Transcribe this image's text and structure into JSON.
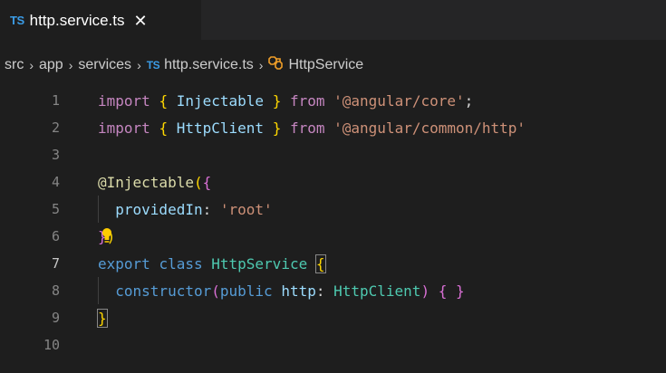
{
  "tab": {
    "badge": "TS",
    "filename": "http.service.ts",
    "close": "✕"
  },
  "breadcrumb": {
    "items": [
      "src",
      "app",
      "services",
      "http.service.ts",
      "HttpService"
    ],
    "file_badge": "TS",
    "separator": "›"
  },
  "editor": {
    "active_line": 7,
    "lines": [
      {
        "n": "1",
        "tokens": [
          [
            "kw-purple",
            "import"
          ],
          [
            "plain",
            " "
          ],
          [
            "brace-y",
            "{"
          ],
          [
            "plain",
            " "
          ],
          [
            "ident",
            "Injectable"
          ],
          [
            "plain",
            " "
          ],
          [
            "brace-y",
            "}"
          ],
          [
            "plain",
            " "
          ],
          [
            "kw-purple",
            "from"
          ],
          [
            "plain",
            " "
          ],
          [
            "str",
            "'@angular/core'"
          ],
          [
            "plain",
            ";"
          ]
        ]
      },
      {
        "n": "2",
        "tokens": [
          [
            "kw-purple",
            "import"
          ],
          [
            "plain",
            " "
          ],
          [
            "brace-y",
            "{"
          ],
          [
            "plain",
            " "
          ],
          [
            "ident",
            "HttpClient"
          ],
          [
            "plain",
            " "
          ],
          [
            "brace-y",
            "}"
          ],
          [
            "plain",
            " "
          ],
          [
            "kw-purple",
            "from"
          ],
          [
            "plain",
            " "
          ],
          [
            "str",
            "'@angular/common/http'"
          ]
        ]
      },
      {
        "n": "3",
        "tokens": []
      },
      {
        "n": "4",
        "tokens": [
          [
            "fn",
            "@Injectable"
          ],
          [
            "brace-y",
            "("
          ],
          [
            "brace-p",
            "{"
          ]
        ]
      },
      {
        "n": "5",
        "tokens": [
          [
            "plain",
            "  "
          ],
          [
            "ident",
            "providedIn"
          ],
          [
            "plain",
            ": "
          ],
          [
            "str",
            "'root'"
          ]
        ]
      },
      {
        "n": "6",
        "tokens": [
          [
            "brace-p",
            "}"
          ],
          [
            "brace-y",
            ")"
          ]
        ]
      },
      {
        "n": "7",
        "tokens": [
          [
            "kw-blue",
            "export"
          ],
          [
            "plain",
            " "
          ],
          [
            "kw-blue",
            "class"
          ],
          [
            "plain",
            " "
          ],
          [
            "type",
            "HttpService"
          ],
          [
            "plain",
            " "
          ],
          [
            "brace-y",
            "{"
          ]
        ]
      },
      {
        "n": "8",
        "tokens": [
          [
            "plain",
            "  "
          ],
          [
            "kw-blue",
            "constructor"
          ],
          [
            "brace-p",
            "("
          ],
          [
            "kw-blue",
            "public"
          ],
          [
            "plain",
            " "
          ],
          [
            "ident",
            "http"
          ],
          [
            "plain",
            ": "
          ],
          [
            "type",
            "HttpClient"
          ],
          [
            "brace-p",
            ")"
          ],
          [
            "plain",
            " "
          ],
          [
            "brace-p",
            "{"
          ],
          [
            "plain",
            " "
          ],
          [
            "brace-p",
            "}"
          ]
        ]
      },
      {
        "n": "9",
        "tokens": [
          [
            "brace-y",
            "}"
          ]
        ]
      },
      {
        "n": "10",
        "tokens": []
      }
    ]
  },
  "colors": {
    "background": "#1e1e1e",
    "tabbar": "#252526",
    "ts_badge": "#3b9ce6",
    "class_icon": "#ee9d28",
    "lightbulb": "#ffcc00"
  },
  "icons": {
    "class_icon": "symbol-class-icon",
    "lightbulb": "lightbulb-icon"
  }
}
